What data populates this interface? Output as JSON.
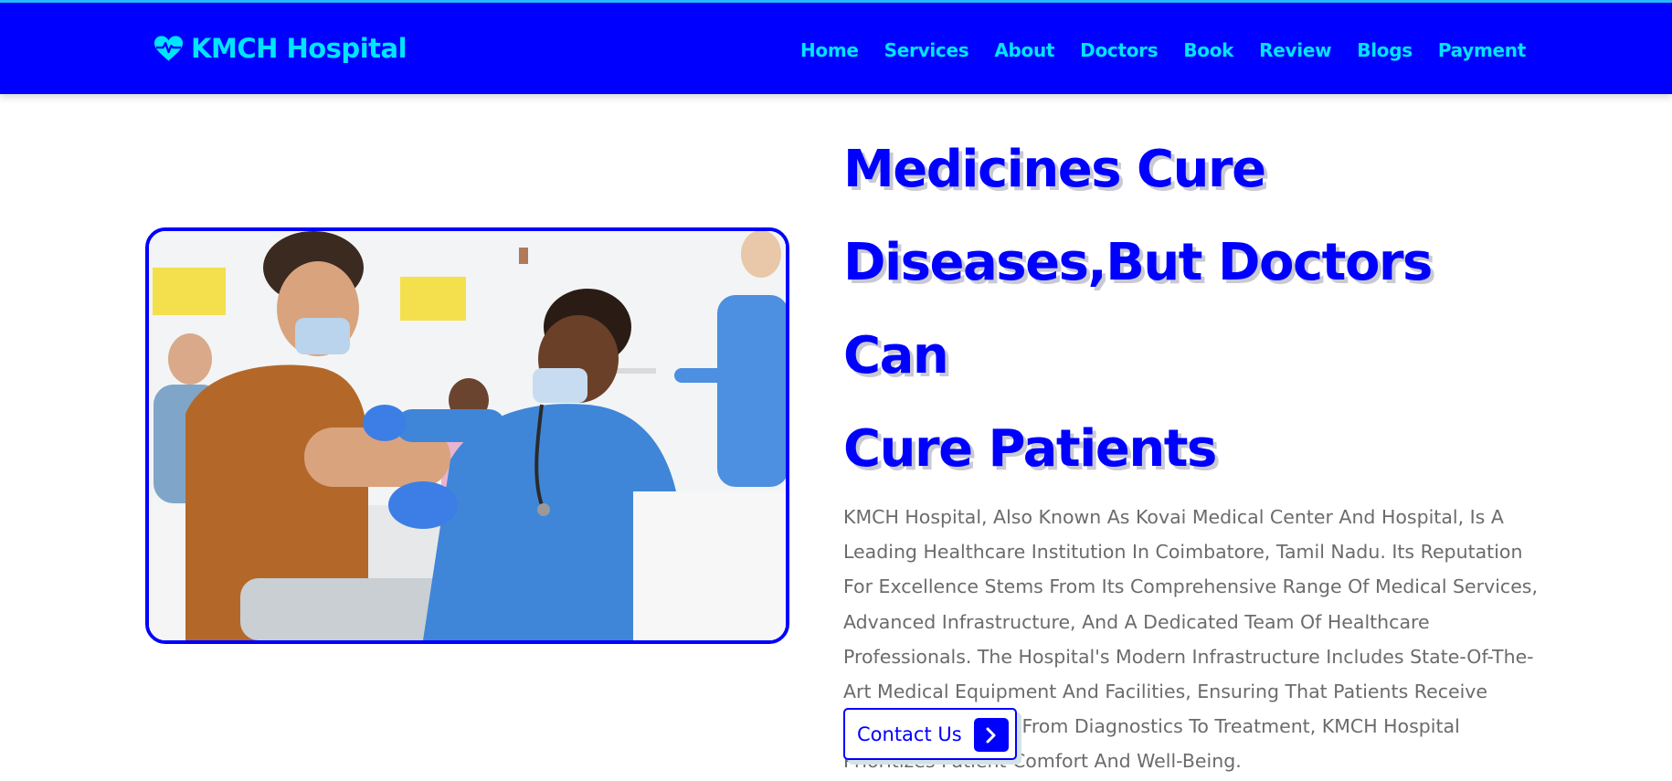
{
  "header": {
    "brand": "KMCH Hospital",
    "brand_icon": "heartbeat-icon",
    "nav": [
      {
        "label": "Home"
      },
      {
        "label": "Services"
      },
      {
        "label": "About"
      },
      {
        "label": "Doctors"
      },
      {
        "label": "Book"
      },
      {
        "label": "Review"
      },
      {
        "label": "Blogs"
      },
      {
        "label": "Payment"
      }
    ]
  },
  "hero": {
    "image_alt": "",
    "headline_lines": [
      "Medicines Cure",
      "Diseases,But Doctors Can",
      "Cure Patients"
    ],
    "description": "KMCH Hospital, Also Known As Kovai Medical Center And Hospital, Is A Leading Healthcare Institution In Coimbatore, Tamil Nadu. Its Reputation For Excellence Stems From Its Comprehensive Range Of Medical Services, Advanced Infrastructure, And A Dedicated Team Of Healthcare Professionals. The Hospital's Modern Infrastructure Includes State-Of-The-Art Medical Equipment And Facilities, Ensuring That Patients Receive High-Quality Care. From Diagnostics To Treatment, KMCH Hospital Prioritizes Patient Comfort And Well-Being.",
    "cta_label": "Contact Us",
    "cta_icon": "chevron-right-icon"
  },
  "colors": {
    "primary": "#0000ff",
    "accent": "#00e5ff",
    "text_gray": "#6b6b6b"
  }
}
